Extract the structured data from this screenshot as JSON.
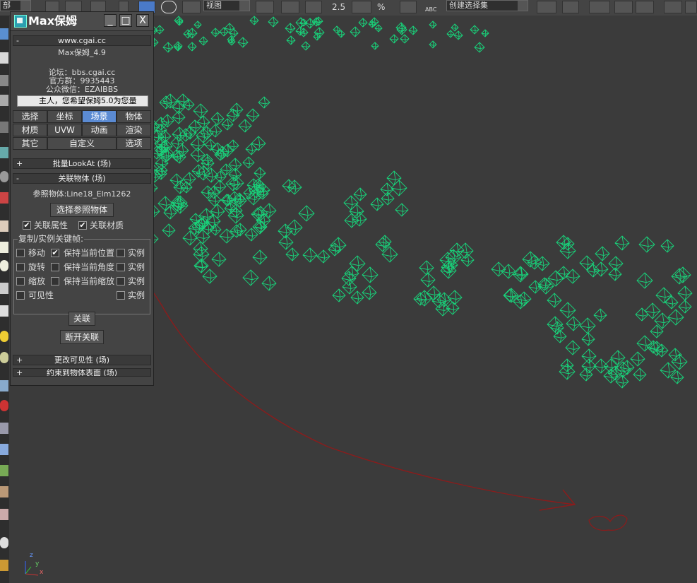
{
  "toolbar": {
    "left_label": "部",
    "view_select": "视图",
    "num_25": "2.5",
    "percent": "%",
    "abc": "ABC",
    "named_set": "创建选择集"
  },
  "panel": {
    "title": "Max保姆",
    "win_buttons": [
      "_",
      "□",
      "X"
    ],
    "site_header": "www.cgai.cc",
    "version": "Max保姆_4.9",
    "forum": "论坛：bbs.cgai.cc",
    "qq_group": "官方群：9935443",
    "wechat": "公众微信：EZAIBBS",
    "banner": "主人，您希望保姆5.0为您量",
    "tabs_row1": [
      "选择",
      "坐标",
      "场景",
      "物体"
    ],
    "tabs_row2": [
      "材质",
      "UVW",
      "动画",
      "渲染"
    ],
    "tabs_row3": [
      "其它",
      "自定义",
      "选项"
    ],
    "active_tab": "场景",
    "rollout_lookat": "批量LookAt (场)",
    "rollout_link": "关联物体 (场)",
    "ref_object": "参照物体:Line18_Elm1262",
    "select_ref_button": "选择参照物体",
    "link_props": "关联属性",
    "link_material": "关联材质",
    "group_title": "复制/实例关键帧:",
    "rows": [
      {
        "label": "移动",
        "keep": "保持当前位置",
        "inst": "实例",
        "keep_checked": true
      },
      {
        "label": "旋转",
        "keep": "保持当前角度",
        "inst": "实例",
        "keep_checked": false
      },
      {
        "label": "缩放",
        "keep": "保持当前缩放",
        "inst": "实例",
        "keep_checked": false
      },
      {
        "label": "可见性",
        "keep": "",
        "inst": "实例",
        "keep_checked": false
      }
    ],
    "link_button": "关联",
    "unlink_button": "断开关联",
    "rollout_visibility": "更改可见性 (场)",
    "rollout_constrain": "约束到物体表面 (场)",
    "plus": "+",
    "minus": "-"
  },
  "axis": {
    "x": "x",
    "y": "y",
    "z": "z"
  },
  "colors": {
    "mesh": "#19d27a",
    "annotation": "#8a1c1c",
    "active_tab": "#5b8bd3"
  }
}
